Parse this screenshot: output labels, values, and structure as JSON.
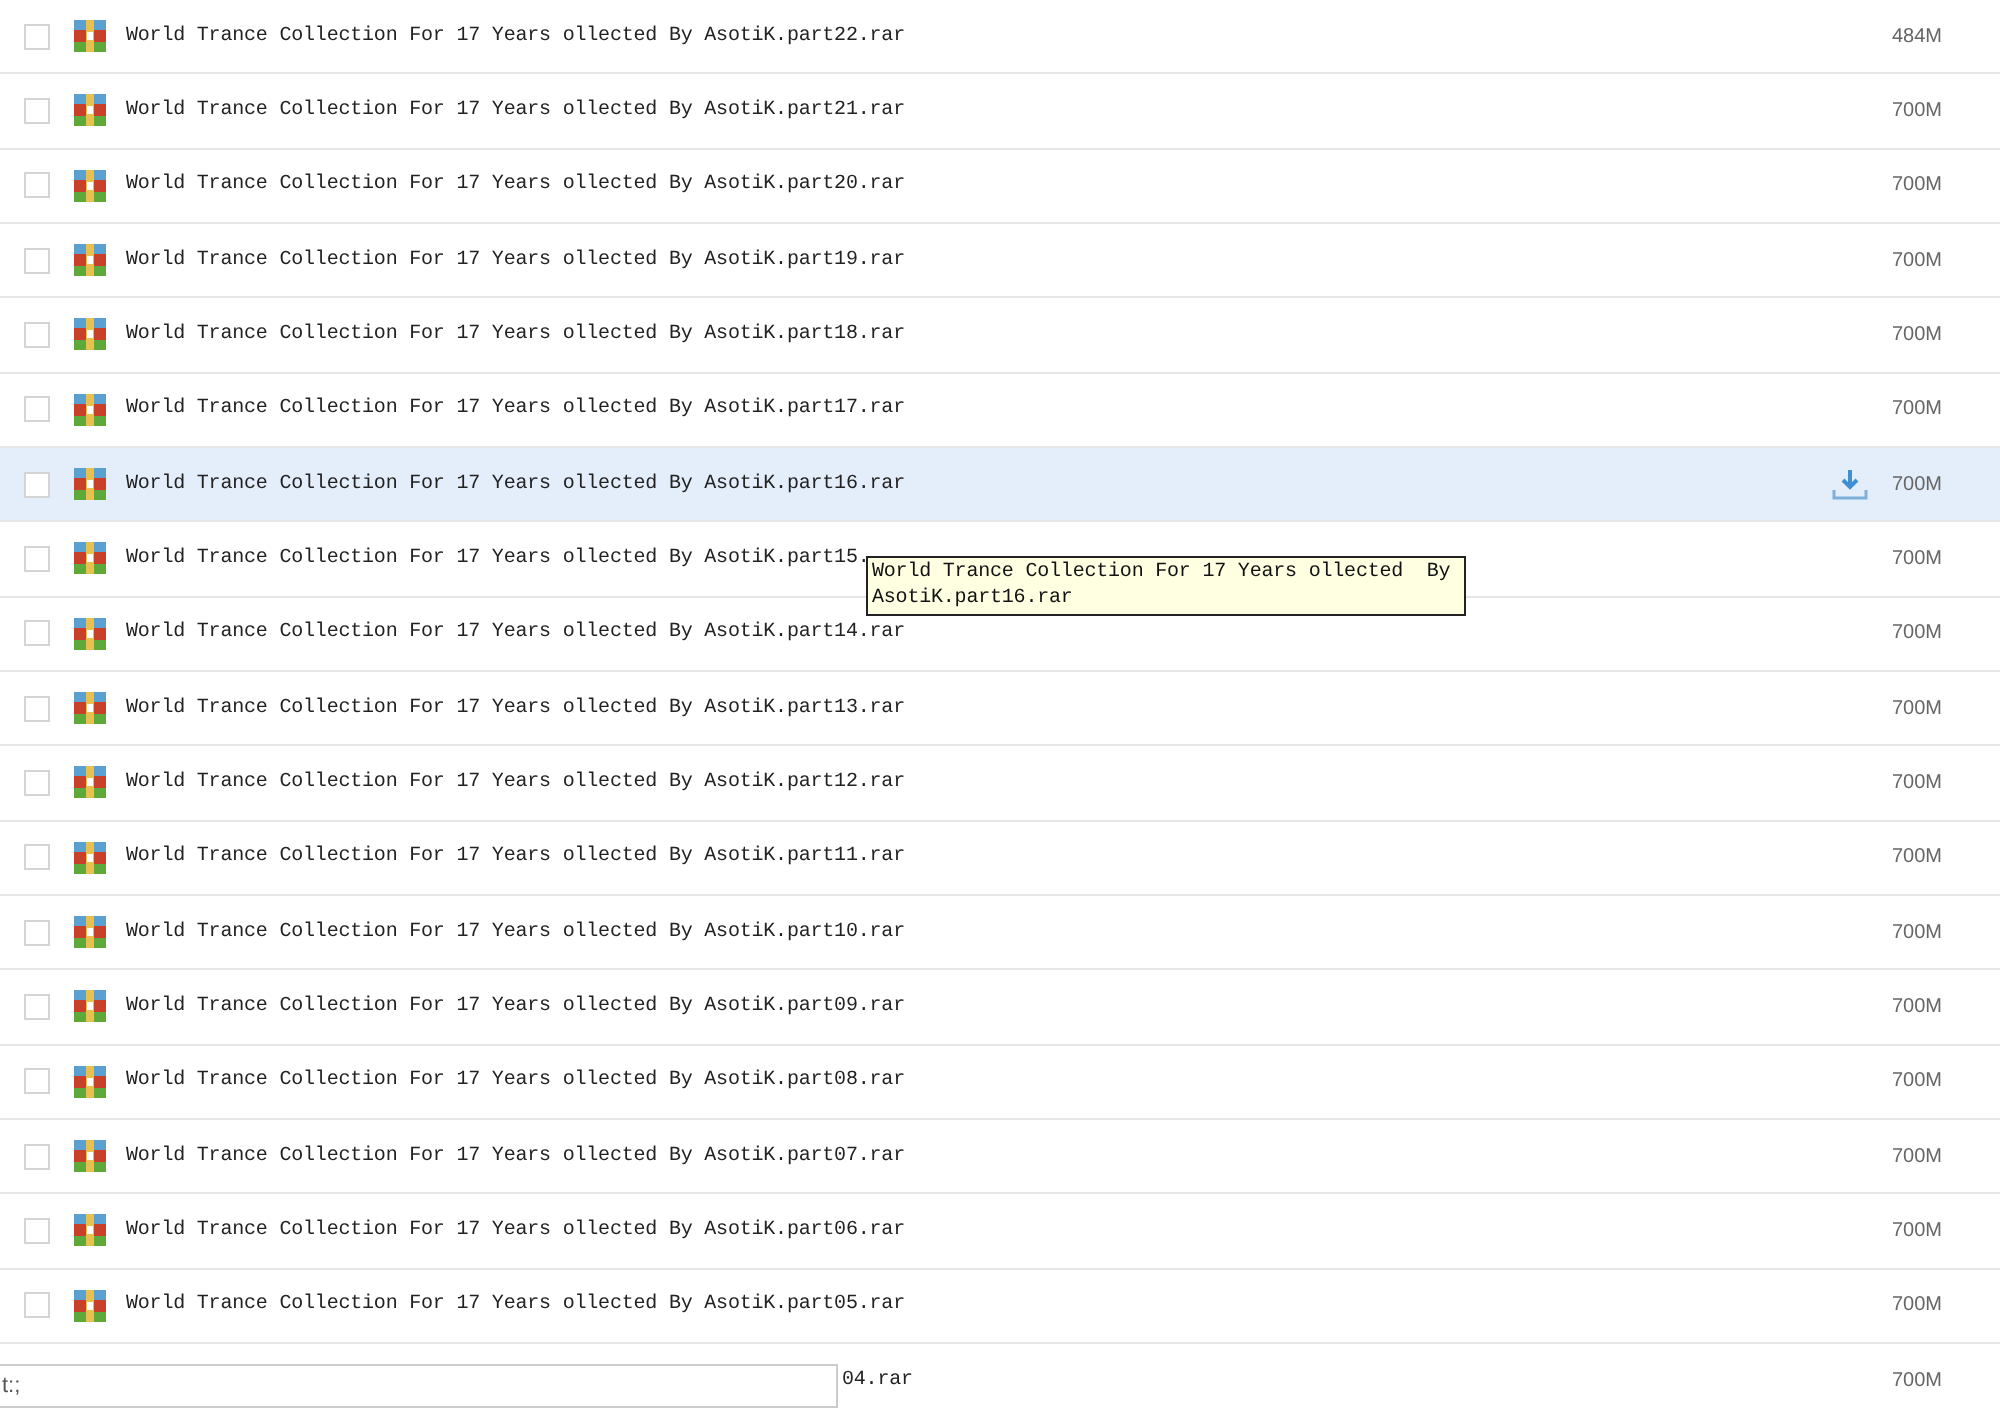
{
  "files": [
    {
      "name": "World Trance Collection For 17 Years ollected By AsotiK.part22.rar",
      "size": "484M",
      "checked": false,
      "hovered": false,
      "kind": "full"
    },
    {
      "name": "World Trance Collection For 17 Years ollected By AsotiK.part21.rar",
      "size": "700M",
      "checked": false,
      "hovered": false,
      "kind": "full"
    },
    {
      "name": "World Trance Collection For 17 Years ollected By AsotiK.part20.rar",
      "size": "700M",
      "checked": false,
      "hovered": false,
      "kind": "full"
    },
    {
      "name": "World Trance Collection For 17 Years ollected By AsotiK.part19.rar",
      "size": "700M",
      "checked": false,
      "hovered": false,
      "kind": "full"
    },
    {
      "name": "World Trance Collection For 17 Years ollected By AsotiK.part18.rar",
      "size": "700M",
      "checked": false,
      "hovered": false,
      "kind": "full"
    },
    {
      "name": "World Trance Collection For 17 Years ollected By AsotiK.part17.rar",
      "size": "700M",
      "checked": false,
      "hovered": false,
      "kind": "full"
    },
    {
      "name": "World Trance Collection For 17 Years ollected By AsotiK.part16.rar",
      "size": "700M",
      "checked": false,
      "hovered": true,
      "kind": "full"
    },
    {
      "name": "World Trance Collection For 17 Years ollected By AsotiK.part15.",
      "size": "700M",
      "checked": false,
      "hovered": false,
      "kind": "full"
    },
    {
      "name": "World Trance Collection For 17 Years ollected By AsotiK.part14.rar",
      "size": "700M",
      "checked": false,
      "hovered": false,
      "kind": "full"
    },
    {
      "name": "World Trance Collection For 17 Years ollected By AsotiK.part13.rar",
      "size": "700M",
      "checked": false,
      "hovered": false,
      "kind": "full"
    },
    {
      "name": "World Trance Collection For 17 Years ollected By AsotiK.part12.rar",
      "size": "700M",
      "checked": false,
      "hovered": false,
      "kind": "full"
    },
    {
      "name": "World Trance Collection For 17 Years ollected By AsotiK.part11.rar",
      "size": "700M",
      "checked": false,
      "hovered": false,
      "kind": "full"
    },
    {
      "name": "World Trance Collection For 17 Years ollected By AsotiK.part10.rar",
      "size": "700M",
      "checked": false,
      "hovered": false,
      "kind": "full"
    },
    {
      "name": "World Trance Collection For 17 Years ollected By AsotiK.part09.rar",
      "size": "700M",
      "checked": false,
      "hovered": false,
      "kind": "full"
    },
    {
      "name": "World Trance Collection For 17 Years ollected By AsotiK.part08.rar",
      "size": "700M",
      "checked": false,
      "hovered": false,
      "kind": "full"
    },
    {
      "name": "World Trance Collection For 17 Years ollected By AsotiK.part07.rar",
      "size": "700M",
      "checked": false,
      "hovered": false,
      "kind": "full"
    },
    {
      "name": "World Trance Collection For 17 Years ollected By AsotiK.part06.rar",
      "size": "700M",
      "checked": false,
      "hovered": false,
      "kind": "full"
    },
    {
      "name": "World Trance Collection For 17 Years ollected By AsotiK.part05.rar",
      "size": "700M",
      "checked": false,
      "hovered": false,
      "kind": "full"
    },
    {
      "name": "04.rar",
      "size": "700M",
      "hovered": false,
      "kind": "covered"
    }
  ],
  "tooltip": {
    "text": "World Trance Collection For 17 Years ollected  By AsotiK.part16.rar"
  },
  "bottom_field": {
    "value": "t:;"
  }
}
